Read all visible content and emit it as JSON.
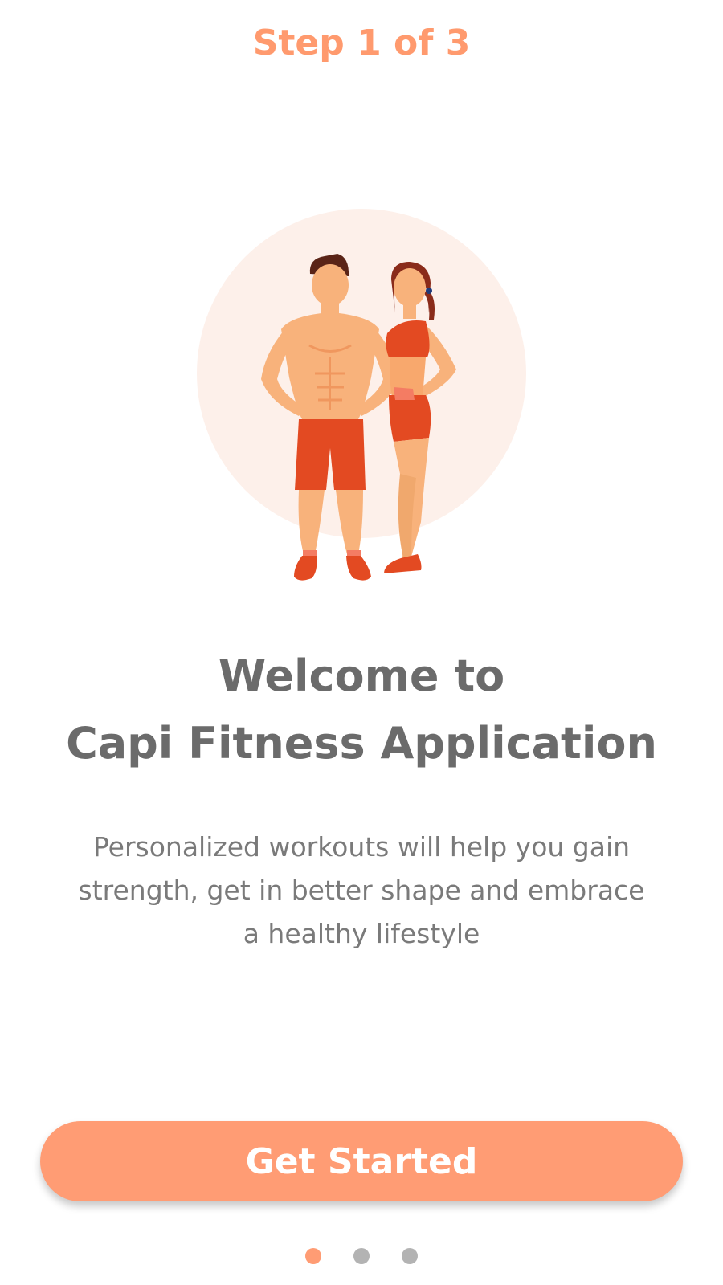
{
  "header": {
    "step_label": "Step 1 of 3"
  },
  "hero": {
    "illustration": "fitness-couple-illustration"
  },
  "content": {
    "title_line1": "Welcome to",
    "title_line2": "Capi Fitness Application",
    "description": "Personalized workouts will help you gain strength, get in better shape and embrace a healthy lifestyle"
  },
  "actions": {
    "primary_label": "Get Started"
  },
  "pager": {
    "current": 1,
    "total": 3
  },
  "colors": {
    "accent": "#ff9c74",
    "step_text": "#ff9a6e",
    "title_text": "#6b6b6b",
    "body_text": "#7a7a7a",
    "hero_circle": "#fdf0ea",
    "dot_inactive": "#b3b3b3"
  }
}
